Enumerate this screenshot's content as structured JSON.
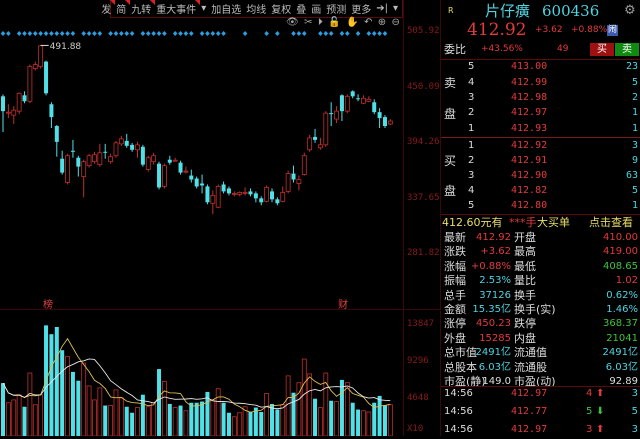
{
  "toolbar": {
    "items": [
      "发",
      "简",
      "九转",
      "重大事件",
      "▾",
      "加自选",
      "均线",
      "复权",
      "叠",
      "画",
      "预测",
      "更多",
      "➔|",
      "▾"
    ]
  },
  "tools": [
    "eye-icon",
    "scissors-icon",
    "play-icon",
    "lock-icon",
    "hand-icon",
    "undo-icon",
    "zoom-in-icon",
    "zoom-out-icon"
  ],
  "axis": {
    "price": [
      "505.92",
      "450.09",
      "394.26",
      "337.65",
      "281.82"
    ],
    "volume": [
      "13847",
      "9296",
      "4648",
      "X10"
    ]
  },
  "markers": {
    "high": "491.88",
    "m1": "榜",
    "m2": "财"
  },
  "colors": {
    "up": "#c0302e",
    "down": "#4fe0e8",
    "ma5": "#e0c050",
    "ma10": "#e8e8e8",
    "diamond": "#2a9fe0"
  },
  "chart_data": {
    "type": "candlestick",
    "ylim": [
      281.82,
      505.92
    ],
    "ohlc_note": "[open, close, high, low]",
    "candles": [
      [
        440,
        425,
        442,
        404
      ],
      [
        424,
        424,
        432,
        418
      ],
      [
        421,
        426,
        430,
        412
      ],
      [
        425,
        443,
        444,
        422
      ],
      [
        441,
        435,
        445,
        433
      ],
      [
        435,
        470,
        472,
        433
      ],
      [
        468,
        472,
        475,
        466
      ],
      [
        470,
        491,
        491.88,
        468
      ],
      [
        475,
        443,
        476,
        441
      ],
      [
        432,
        419,
        434,
        408
      ],
      [
        410,
        394,
        411,
        379
      ],
      [
        377,
        363,
        385,
        361
      ],
      [
        353,
        380,
        382,
        351
      ],
      [
        385,
        384,
        396,
        378
      ],
      [
        378,
        369,
        380,
        359
      ],
      [
        359,
        374,
        376,
        338
      ],
      [
        370,
        380,
        382,
        368
      ],
      [
        374,
        381,
        384,
        372
      ],
      [
        371,
        383,
        392,
        369
      ],
      [
        384,
        383,
        392,
        377
      ],
      [
        374,
        379,
        382,
        372
      ],
      [
        380,
        393,
        395,
        378
      ],
      [
        392,
        397,
        400,
        390
      ],
      [
        395,
        390,
        402,
        388
      ],
      [
        391,
        386,
        393,
        384
      ],
      [
        386,
        391,
        394,
        378
      ],
      [
        389,
        371,
        391,
        369
      ],
      [
        366,
        378,
        380,
        364
      ],
      [
        374,
        380,
        383,
        371
      ],
      [
        372,
        348,
        374,
        346
      ],
      [
        349,
        370,
        372,
        347
      ],
      [
        376,
        373,
        380,
        371
      ],
      [
        375,
        375.5,
        378,
        374
      ],
      [
        373,
        363,
        375,
        361
      ],
      [
        364,
        364.5,
        369,
        362
      ],
      [
        360,
        356,
        366,
        353
      ],
      [
        357,
        349,
        359,
        347
      ],
      [
        352,
        350,
        361,
        342
      ],
      [
        349,
        333,
        351,
        331
      ],
      [
        332,
        340,
        345,
        321
      ],
      [
        328,
        349,
        351,
        327
      ],
      [
        351,
        344,
        354,
        342
      ],
      [
        347,
        342,
        349,
        340
      ],
      [
        341,
        342,
        344,
        339
      ],
      [
        341,
        343,
        344,
        339
      ],
      [
        342,
        343,
        348,
        340
      ],
      [
        344,
        341,
        347,
        339
      ],
      [
        342,
        337,
        344,
        333
      ],
      [
        337,
        333,
        339,
        330
      ],
      [
        334,
        348,
        350,
        333
      ],
      [
        344,
        336,
        347,
        333
      ],
      [
        336,
        332,
        338,
        330
      ],
      [
        334,
        343,
        349,
        333
      ],
      [
        344,
        362,
        365,
        342
      ],
      [
        362,
        356,
        370,
        353
      ],
      [
        352,
        356,
        360,
        345
      ],
      [
        361,
        380,
        383,
        360
      ],
      [
        386,
        398,
        401,
        384
      ],
      [
        399,
        396,
        407,
        393
      ],
      [
        388,
        391,
        398,
        386
      ],
      [
        391,
        423,
        425,
        389
      ],
      [
        423,
        422.5,
        434,
        410
      ],
      [
        417,
        425,
        430,
        413
      ],
      [
        441,
        425,
        442,
        415
      ],
      [
        425,
        440,
        442,
        423
      ],
      [
        445,
        440,
        446,
        438
      ],
      [
        438,
        437,
        442,
        435
      ],
      [
        433,
        438,
        441,
        432
      ],
      [
        435,
        437,
        440,
        434
      ],
      [
        434,
        424,
        437,
        422
      ],
      [
        424,
        418,
        428,
        408
      ],
      [
        419,
        410,
        421,
        408
      ],
      [
        412,
        415,
        417,
        411
      ]
    ],
    "volume": [
      6600,
      4150,
      4500,
      5150,
      3650,
      7850,
      3900,
      5150,
      13800,
      12700,
      13600,
      10700,
      9900,
      8000,
      6900,
      9100,
      6250,
      4500,
      6000,
      3800,
      3800,
      5750,
      4750,
      3650,
      2900,
      3550,
      5150,
      3650,
      4150,
      8350,
      6800,
      4000,
      3550,
      3800,
      3150,
      4150,
      4150,
      4300,
      5500,
      4500,
      5900,
      4150,
      2900,
      2400,
      2900,
      3650,
      3000,
      3550,
      3000,
      5300,
      4000,
      3300,
      3900,
      7500,
      5400,
      6650,
      9600,
      7750,
      4650,
      3550,
      7850,
      4400,
      4300,
      7000,
      6650,
      4150,
      3300,
      3150,
      3000,
      4150,
      5000,
      3800,
      3900
    ],
    "volume_ylim": [
      0,
      13847
    ],
    "signals": [
      1,
      1,
      0,
      1,
      1,
      1,
      1,
      1,
      1,
      1,
      1,
      1,
      1,
      1,
      0,
      1,
      1,
      1,
      1,
      0,
      1,
      1,
      1,
      1,
      1,
      0,
      1,
      1,
      1,
      1,
      1,
      0,
      1,
      1,
      1,
      1,
      0,
      1,
      1,
      1,
      1,
      1,
      0,
      0,
      0,
      1,
      0,
      0,
      0,
      1,
      0,
      1,
      0,
      0,
      1,
      1,
      1,
      0,
      0,
      1,
      1,
      1,
      0,
      1,
      1,
      0,
      1,
      0,
      1,
      1,
      1,
      1,
      0
    ]
  },
  "quote": {
    "r": "R",
    "name": "片仔癀",
    "code": "600436",
    "price": "412.92",
    "change": "+3.62",
    "pct": "+0.88%",
    "alert": "闹",
    "weibi_label": "委比",
    "weibi": "+43.56%",
    "weicha": "49",
    "buy": "买",
    "sell": "卖"
  },
  "book": {
    "sell_label": [
      "卖",
      "盘"
    ],
    "buy_label": [
      "买",
      "盘"
    ],
    "sells": [
      {
        "lv": "5",
        "p": "413.00",
        "v": "23"
      },
      {
        "lv": "4",
        "p": "412.99",
        "v": "5"
      },
      {
        "lv": "3",
        "p": "412.98",
        "v": "2"
      },
      {
        "lv": "2",
        "p": "412.97",
        "v": "1"
      },
      {
        "lv": "1",
        "p": "412.93",
        "v": "1"
      }
    ],
    "buys": [
      {
        "lv": "1",
        "p": "412.92",
        "v": "3"
      },
      {
        "lv": "2",
        "p": "412.91",
        "v": "9"
      },
      {
        "lv": "3",
        "p": "412.90",
        "v": "63"
      },
      {
        "lv": "4",
        "p": "412.82",
        "v": "5"
      },
      {
        "lv": "5",
        "p": "412.80",
        "v": "1"
      }
    ]
  },
  "bigorder": {
    "a": "412.60元有",
    "b": "***手",
    "c": "大买单",
    "d": "点击查看"
  },
  "stats": [
    [
      "最新",
      "412.92",
      "red",
      "开盘",
      "410.00",
      "red"
    ],
    [
      "涨跌",
      "+3.62",
      "red",
      "最高",
      "419.00",
      "red"
    ],
    [
      "涨幅",
      "+0.88%",
      "red",
      "最低",
      "408.65",
      "green"
    ],
    [
      "振幅",
      "2.53%",
      "cyan",
      "量比",
      "1.02",
      "red"
    ],
    [
      "总手",
      "37126",
      "cyan",
      "换手",
      "0.62%",
      "cyan"
    ],
    [
      "金额",
      "15.35亿",
      "cyan",
      "换手(实)",
      "1.46%",
      "cyan"
    ],
    [
      "涨停",
      "450.23",
      "red",
      "跌停",
      "368.37",
      "green"
    ],
    [
      "外盘",
      "15285",
      "red",
      "内盘",
      "21041",
      "green"
    ],
    [
      "总市值",
      "2491亿",
      "cyan",
      "流通值",
      "2491亿",
      "cyan"
    ],
    [
      "总股本",
      "6.03亿",
      "cyan",
      "流通股",
      "6.03亿",
      "cyan"
    ],
    [
      "市盈(静)",
      "149.0",
      "wht",
      "市盈(动)",
      "92.89",
      "wht"
    ]
  ],
  "trades": [
    {
      "t": "14:56",
      "p": "412.97",
      "v": "4",
      "dir": "up",
      "n": "3"
    },
    {
      "t": "14:56",
      "p": "412.77",
      "v": "5",
      "dir": "down",
      "n": "5"
    },
    {
      "t": "14:56",
      "p": "412.97",
      "v": "3",
      "dir": "up",
      "n": "3"
    }
  ]
}
